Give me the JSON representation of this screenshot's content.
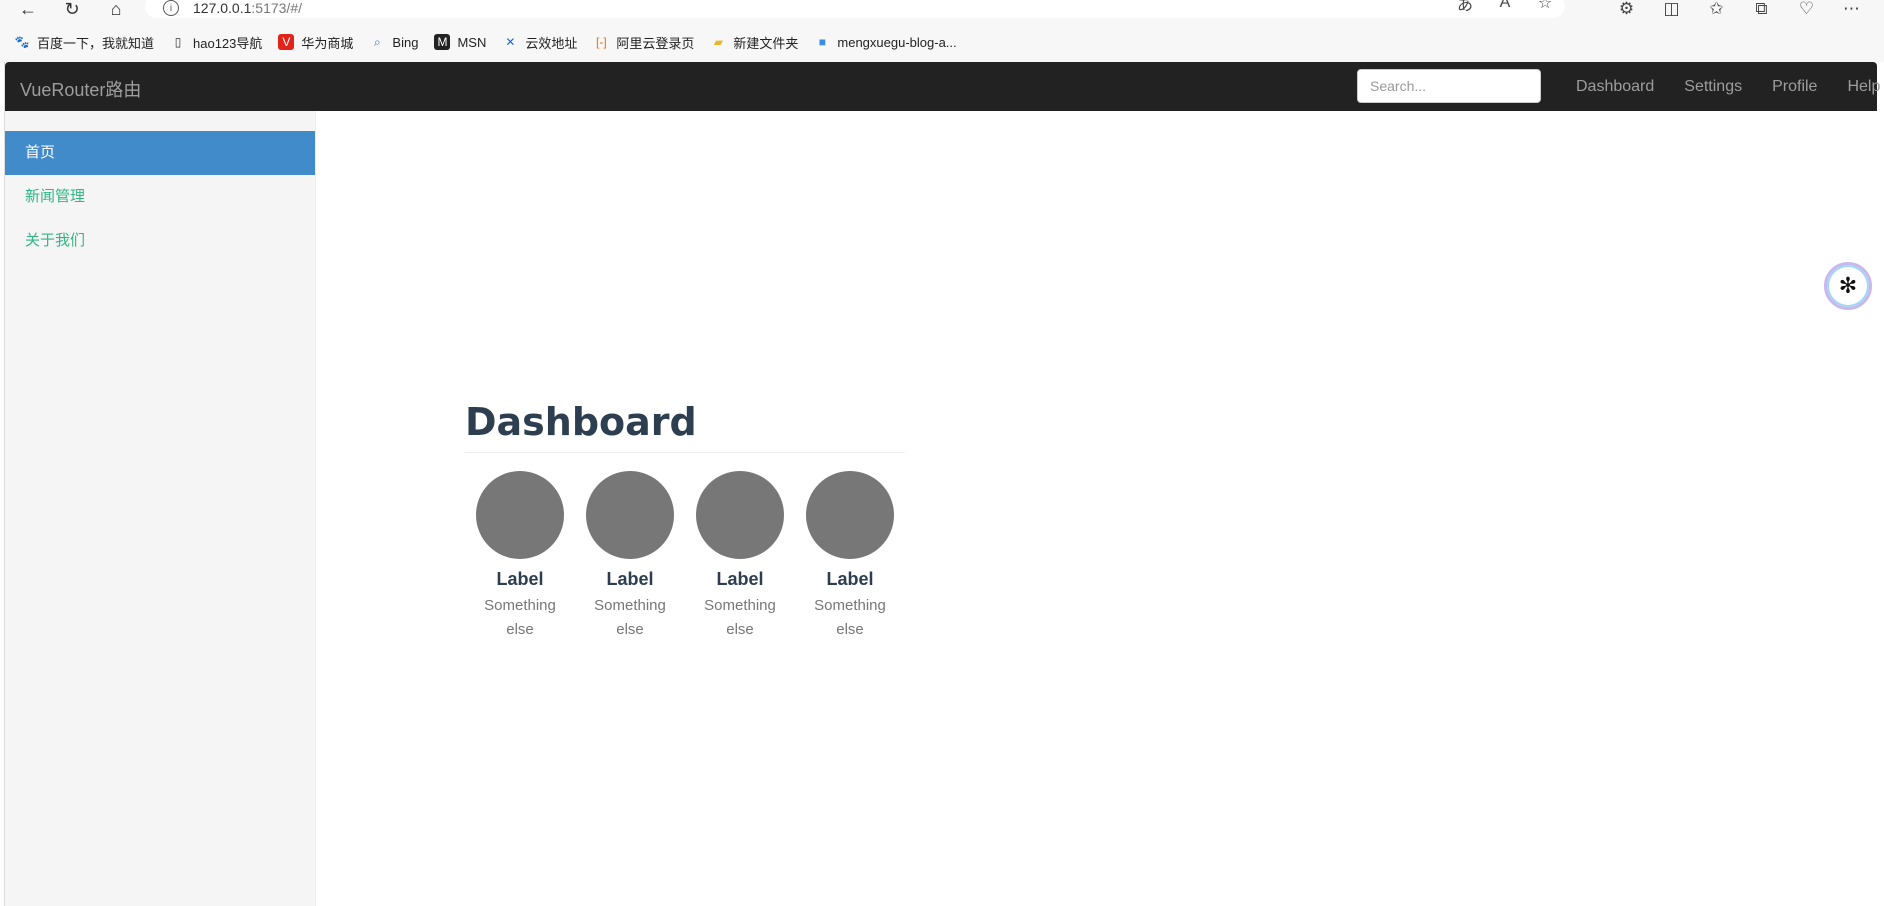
{
  "browser": {
    "url_main": "127.0.0.1",
    "url_rest": ":5173/#/",
    "bookmarks": [
      {
        "label": "百度一下，我就知道",
        "icon": "baidu-icon",
        "color": "#2932e1"
      },
      {
        "label": "hao123导航",
        "icon": "page-icon",
        "color": "#333333"
      },
      {
        "label": "华为商城",
        "icon": "huawei-icon",
        "color": "#e2231a"
      },
      {
        "label": "Bing",
        "icon": "search-icon",
        "color": "#2e6fd8"
      },
      {
        "label": "MSN",
        "icon": "msn-icon",
        "color": "#222222"
      },
      {
        "label": "云效地址",
        "icon": "x-icon",
        "color": "#1a6fd6"
      },
      {
        "label": "阿里云登录页",
        "icon": "aliyun-icon",
        "color": "#ff6a00"
      },
      {
        "label": "新建文件夹",
        "icon": "folder-icon",
        "color": "#e8b730"
      },
      {
        "label": "mengxuegu-blog-a...",
        "icon": "bookmark-icon",
        "color": "#3a8ee6"
      }
    ]
  },
  "app": {
    "brand": "VueRouter路由",
    "search_placeholder": "Search...",
    "topnav": [
      "Dashboard",
      "Settings",
      "Profile",
      "Help"
    ],
    "sidebar": [
      "首页",
      "新闻管理",
      "关于我们"
    ],
    "page_title": "Dashboard",
    "placeholders": [
      {
        "label": "Label",
        "sub": "Something else"
      },
      {
        "label": "Label",
        "sub": "Something else"
      },
      {
        "label": "Label",
        "sub": "Something else"
      },
      {
        "label": "Label",
        "sub": "Something else"
      }
    ]
  },
  "colors": {
    "topbar": "#222222",
    "active_sidebar": "#428bca",
    "sidebar_link": "#2fb785",
    "placeholder_circle": "#777777"
  }
}
